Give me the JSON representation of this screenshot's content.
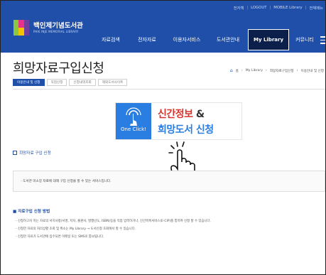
{
  "header": {
    "utility_links": [
      "전자책",
      "LOGOUT",
      "MOBILE Library",
      "전체메뉴"
    ],
    "logo": {
      "name": "백인제기념도서관",
      "subtitle": "PAIK INJE MEMORIAL LIBRARY"
    },
    "menu": [
      {
        "label": "자료검색",
        "active": false
      },
      {
        "label": "전자자료",
        "active": false
      },
      {
        "label": "이용자서비스",
        "active": false
      },
      {
        "label": "도서관안내",
        "active": false
      },
      {
        "label": "My Library",
        "active": true
      },
      {
        "label": "커뮤니티",
        "active": false
      }
    ]
  },
  "page": {
    "title": "희망자료구입신청",
    "breadcrumb": [
      "홈",
      "My Library",
      "희망자료구입신청",
      "이용안내 및 신청"
    ],
    "tabs": [
      {
        "label": "이용안내 및 신청",
        "active": true
      },
      {
        "label": "직접신청",
        "active": false
      },
      {
        "label": "신청내역조회",
        "active": false
      },
      {
        "label": "해외도서사이트",
        "active": false
      }
    ]
  },
  "banner": {
    "line1": "신간정보",
    "amp": "&",
    "line2": "희망도서 신청",
    "button_text": "One Click!"
  },
  "section1": {
    "heading": "희망자료 구입 신청",
    "description": "- 도서관 미소장 자료에 대해 구입 신청을 할 수 있는 서비스입니다."
  },
  "section2": {
    "heading": "■ 자료구입 신청 방법",
    "steps": [
      "- 신청하고자 하는 자료의 서지사항(서명, 저자, 출판사, 발행년도, ISBN)등을 직접 입력하거나, 신간목록서비스(E-CIP)를 통하여 신청 할 수 있습니다.",
      "- 신청한 자료의 처리상황 조회 및 취소는 My Library → 도서신청 조회에서 할 수 있습니다.",
      "- 신청한 자료가 도서관에 입수되면 이메일 또는 SMS로 통보됩니다."
    ]
  },
  "colors": {
    "brand_blue": "#1f4fa8",
    "active_menu": "#0b1f4a",
    "banner_red": "#d8322b",
    "banner_blue": "#2a7de1"
  },
  "icons": [
    "logo-mark-icon",
    "touch-icon",
    "hand-pointer-icon",
    "home-icon",
    "menu-icon"
  ]
}
